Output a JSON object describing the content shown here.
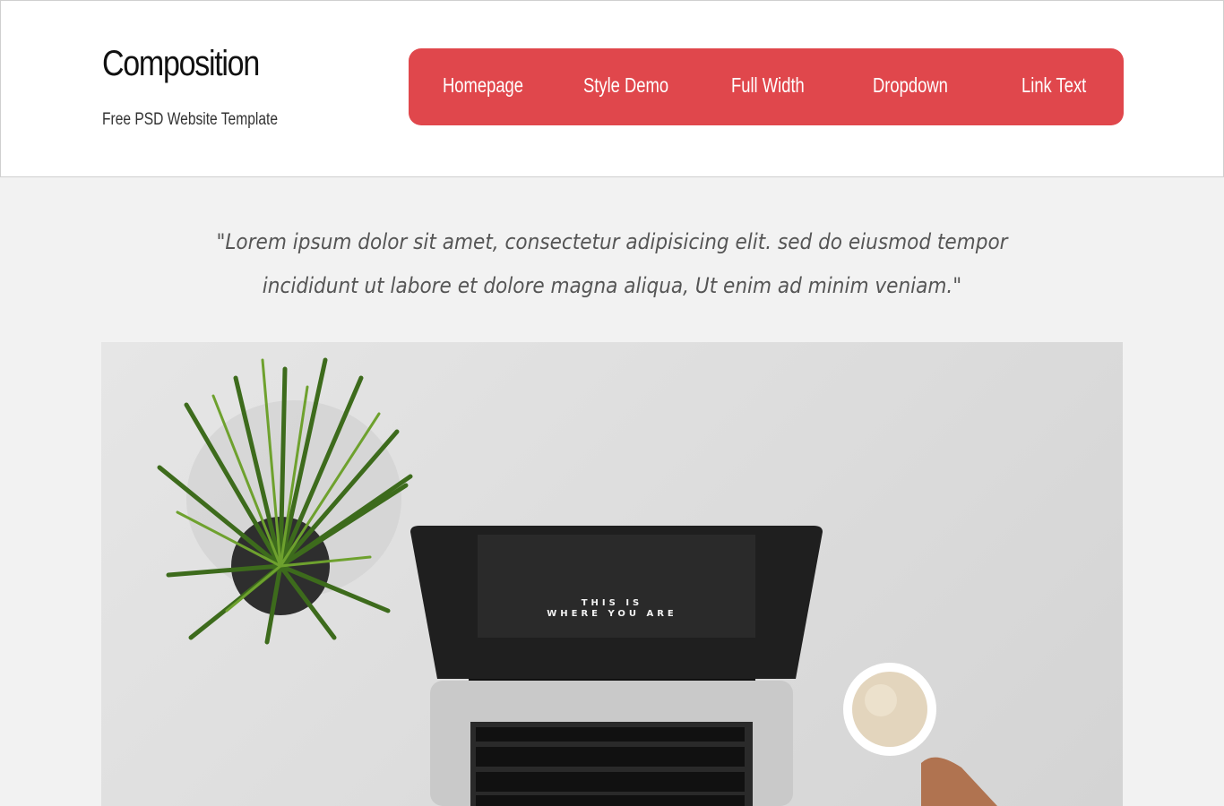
{
  "brand": {
    "title": "Composition",
    "tagline": "Free PSD Website Template"
  },
  "nav": {
    "color": "#e0474c",
    "items": [
      {
        "label": "Homepage"
      },
      {
        "label": "Style Demo"
      },
      {
        "label": "Full Width"
      },
      {
        "label": "Dropdown"
      },
      {
        "label": "Link Text"
      }
    ]
  },
  "quote": {
    "text": "\"Lorem ipsum dolor sit amet, consectetur adipisicing elit. sed do eiusmod tempor incididunt ut labore et dolore magna aliqua, Ut enim ad minim veniam.\""
  },
  "hero": {
    "screen_line1": "THIS IS",
    "screen_line2": "WHERE YOU ARE"
  }
}
